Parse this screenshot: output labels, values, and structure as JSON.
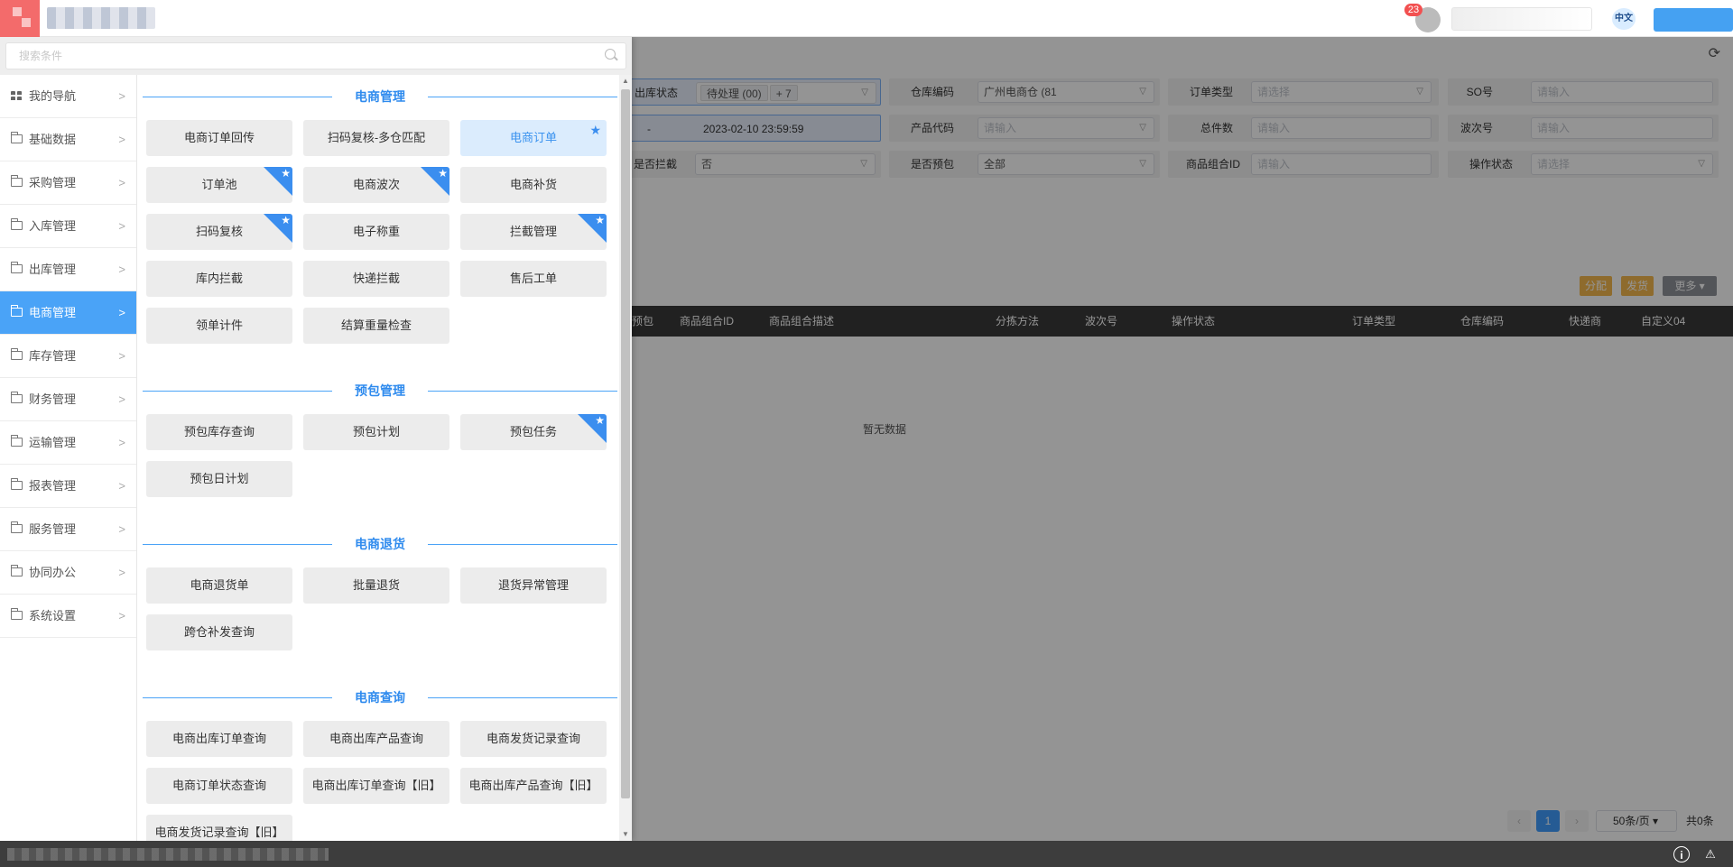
{
  "header": {
    "notification_count": "23",
    "lang_label": "中文"
  },
  "filters": {
    "row1": {
      "outbound_status_label": "出库状态",
      "outbound_status_tag1": "待处理 (00)",
      "outbound_status_tag2": "+ 7",
      "warehouse_label": "仓库编码",
      "warehouse_value": "广州电商仓 (81",
      "order_type_label": "订单类型",
      "order_type_placeholder": "请选择",
      "so_label": "SO号",
      "so_placeholder": "请输入"
    },
    "row2": {
      "date_sep": "-",
      "date_end": "2023-02-10 23:59:59",
      "product_code_label": "产品代码",
      "product_code_placeholder": "请输入",
      "total_count_label": "总件数",
      "total_count_placeholder": "请输入",
      "wave_label": "波次号",
      "wave_placeholder": "请输入"
    },
    "row3": {
      "intercept_label": "是否拦截",
      "intercept_value": "否",
      "prepack_label": "是否预包",
      "prepack_value": "全部",
      "combo_id_label": "商品组合ID",
      "combo_id_placeholder": "请输入",
      "op_status_label": "操作状态",
      "op_status_placeholder": "请选择"
    }
  },
  "actions": {
    "assign": "分配",
    "release": "发货",
    "more": "更多"
  },
  "table": {
    "columns": [
      "预包",
      "商品组合ID",
      "商品组合描述",
      "分拣方法",
      "波次号",
      "操作状态",
      "订单类型",
      "仓库编码",
      "快递商",
      "自定义04"
    ],
    "empty_text": "暂无数据"
  },
  "pagination": {
    "current_page": "1",
    "page_size": "50条/页",
    "total": "共0条"
  },
  "menu": {
    "search_placeholder": "搜索条件",
    "sidebar": [
      {
        "label": "我的导航",
        "icon": "grid-icon",
        "active": false
      },
      {
        "label": "基础数据",
        "icon": "folder-icon",
        "active": false
      },
      {
        "label": "采购管理",
        "icon": "folder-icon",
        "active": false
      },
      {
        "label": "入库管理",
        "icon": "folder-icon",
        "active": false
      },
      {
        "label": "出库管理",
        "icon": "folder-icon",
        "active": false
      },
      {
        "label": "电商管理",
        "icon": "folder-icon",
        "active": true
      },
      {
        "label": "库存管理",
        "icon": "folder-icon",
        "active": false
      },
      {
        "label": "财务管理",
        "icon": "folder-icon",
        "active": false
      },
      {
        "label": "运输管理",
        "icon": "folder-icon",
        "active": false
      },
      {
        "label": "报表管理",
        "icon": "folder-icon",
        "active": false
      },
      {
        "label": "服务管理",
        "icon": "folder-icon",
        "active": false
      },
      {
        "label": "协同办公",
        "icon": "folder-icon",
        "active": false
      },
      {
        "label": "系统设置",
        "icon": "folder-icon",
        "active": false
      }
    ],
    "sections": [
      {
        "title": "电商管理",
        "items": [
          {
            "label": "电商订单回传",
            "starred": false,
            "selected": false
          },
          {
            "label": "扫码复核-多仓匹配",
            "starred": false,
            "selected": false
          },
          {
            "label": "电商订单",
            "starred": true,
            "selected": true
          },
          {
            "label": "订单池",
            "starred": true,
            "selected": false
          },
          {
            "label": "电商波次",
            "starred": true,
            "selected": false
          },
          {
            "label": "电商补货",
            "starred": false,
            "selected": false
          },
          {
            "label": "扫码复核",
            "starred": true,
            "selected": false
          },
          {
            "label": "电子称重",
            "starred": false,
            "selected": false
          },
          {
            "label": "拦截管理",
            "starred": true,
            "selected": false
          },
          {
            "label": "库内拦截",
            "starred": false,
            "selected": false
          },
          {
            "label": "快递拦截",
            "starred": false,
            "selected": false
          },
          {
            "label": "售后工单",
            "starred": false,
            "selected": false
          },
          {
            "label": "领单计件",
            "starred": false,
            "selected": false
          },
          {
            "label": "结算重量检查",
            "starred": false,
            "selected": false
          }
        ]
      },
      {
        "title": "预包管理",
        "items": [
          {
            "label": "预包库存查询",
            "starred": false,
            "selected": false
          },
          {
            "label": "预包计划",
            "starred": false,
            "selected": false
          },
          {
            "label": "预包任务",
            "starred": true,
            "selected": false
          },
          {
            "label": "预包日计划",
            "starred": false,
            "selected": false
          }
        ]
      },
      {
        "title": "电商退货",
        "items": [
          {
            "label": "电商退货单",
            "starred": false,
            "selected": false
          },
          {
            "label": "批量退货",
            "starred": false,
            "selected": false
          },
          {
            "label": "退货异常管理",
            "starred": false,
            "selected": false
          },
          {
            "label": "跨仓补发查询",
            "starred": false,
            "selected": false
          }
        ]
      },
      {
        "title": "电商查询",
        "items": [
          {
            "label": "电商出库订单查询",
            "starred": false,
            "selected": false
          },
          {
            "label": "电商出库产品查询",
            "starred": false,
            "selected": false
          },
          {
            "label": "电商发货记录查询",
            "starred": false,
            "selected": false
          },
          {
            "label": "电商订单状态查询",
            "starred": false,
            "selected": false
          },
          {
            "label": "电商出库订单查询【旧】",
            "starred": false,
            "selected": false
          },
          {
            "label": "电商出库产品查询【旧】",
            "starred": false,
            "selected": false
          },
          {
            "label": "电商发货记录查询【旧】",
            "starred": false,
            "selected": false
          }
        ]
      }
    ]
  },
  "colors": {
    "accent": "#4aa3f7",
    "badge": "#f25050",
    "topbar_logo": "#f36b6b"
  }
}
